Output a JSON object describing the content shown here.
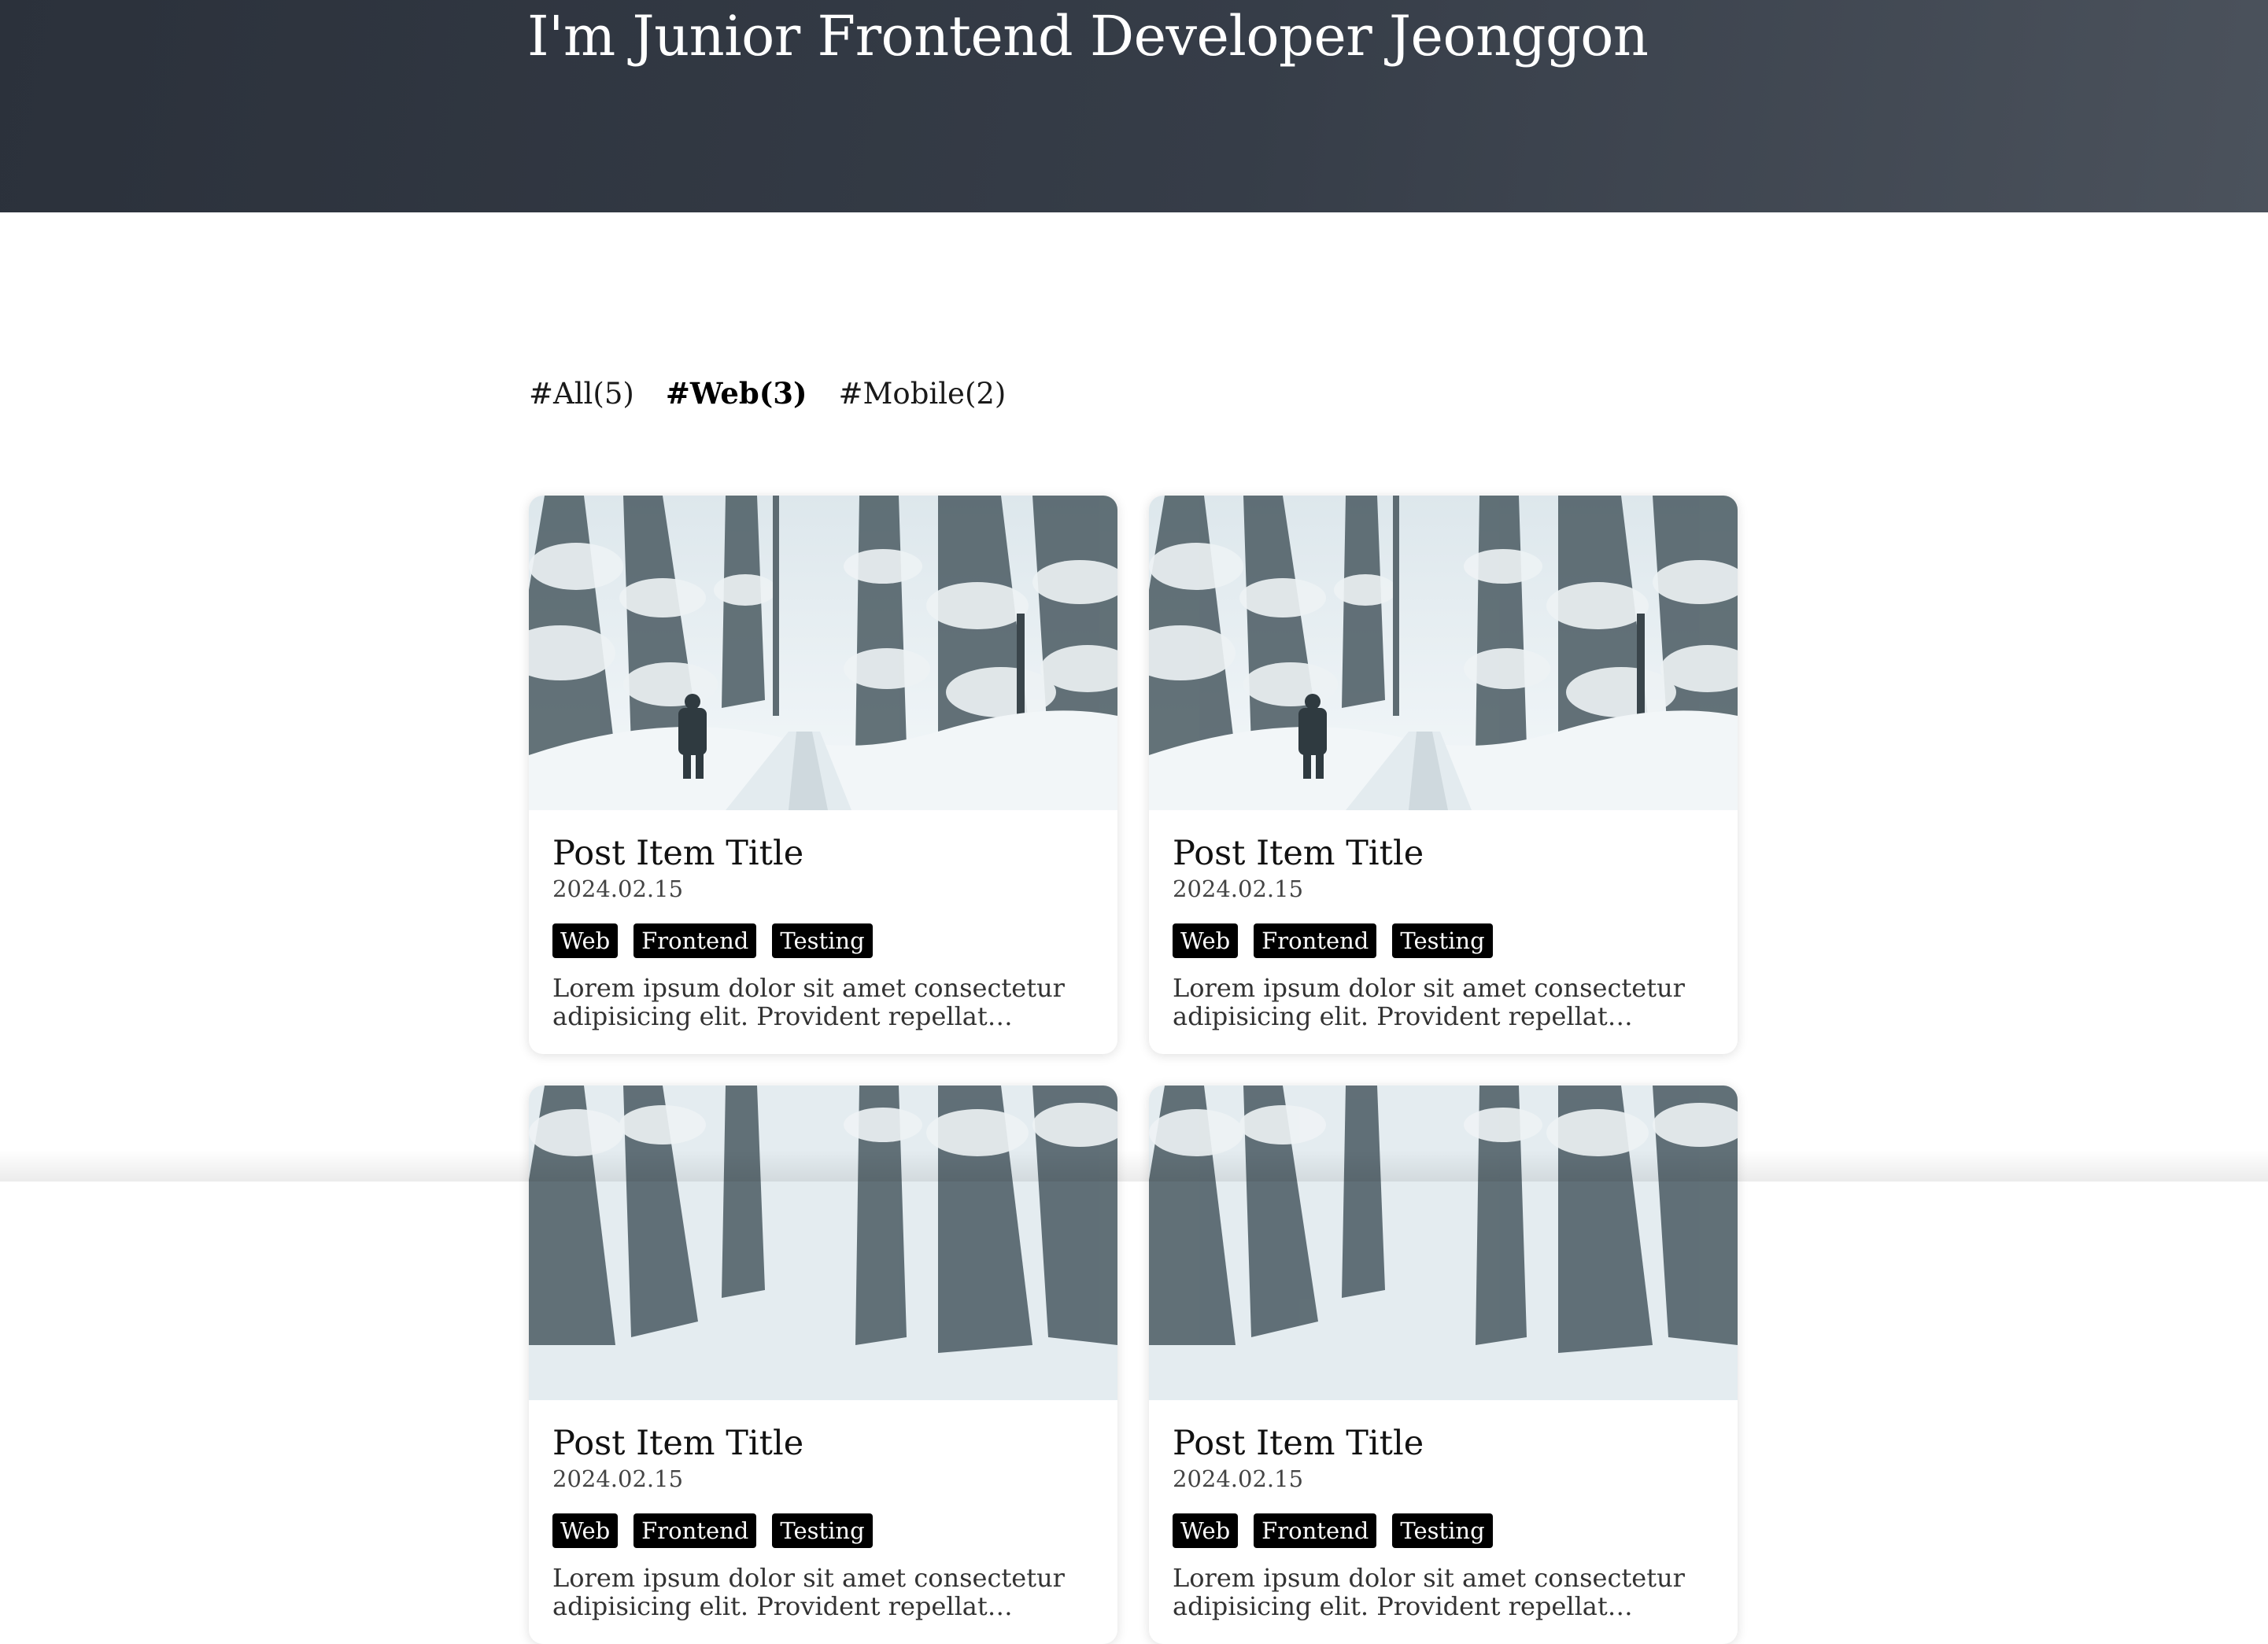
{
  "hero": {
    "title": "I'm Junior Frontend Developer Jeonggon"
  },
  "categories": [
    {
      "label": "#All(5)",
      "active": false
    },
    {
      "label": "#Web(3)",
      "active": true
    },
    {
      "label": "#Mobile(2)",
      "active": false
    }
  ],
  "posts": [
    {
      "title": "Post Item Title",
      "date": "2024.02.15",
      "tags": [
        "Web",
        "Frontend",
        "Testing"
      ],
      "summary": "Lorem ipsum dolor sit amet consectetur adipisicing elit. Provident repellat doloremque fugit quis rem temporibus! Maxime molestias, suntrem debitis odit harum impedit. Modi cupiditate harum dignissimos eos in corrupti!"
    },
    {
      "title": "Post Item Title",
      "date": "2024.02.15",
      "tags": [
        "Web",
        "Frontend",
        "Testing"
      ],
      "summary": "Lorem ipsum dolor sit amet consectetur adipisicing elit. Provident repellat doloremque fugit quis rem temporibus! Maxime molestias, suntrem debitis odit harum impedit. Modi cupiditate harum dignissimos eos in corrupti!"
    },
    {
      "title": "Post Item Title",
      "date": "2024.02.15",
      "tags": [
        "Web",
        "Frontend",
        "Testing"
      ],
      "summary": "Lorem ipsum dolor sit amet consectetur adipisicing elit. Provident repellat doloremque fugit quis rem temporibus!"
    },
    {
      "title": "Post Item Title",
      "date": "2024.02.15",
      "tags": [
        "Web",
        "Frontend",
        "Testing"
      ],
      "summary": "Lorem ipsum dolor sit amet consectetur adipisicing elit. Provident repellat doloremque fugit quis rem temporibus!"
    }
  ],
  "colors": {
    "hero_dark": "#2b313b",
    "hero_light": "#4b525c",
    "tag_bg": "#000000",
    "tag_text": "#ffffff"
  },
  "icons": {
    "thumbnail": "snowy-forest-hiker-image"
  }
}
